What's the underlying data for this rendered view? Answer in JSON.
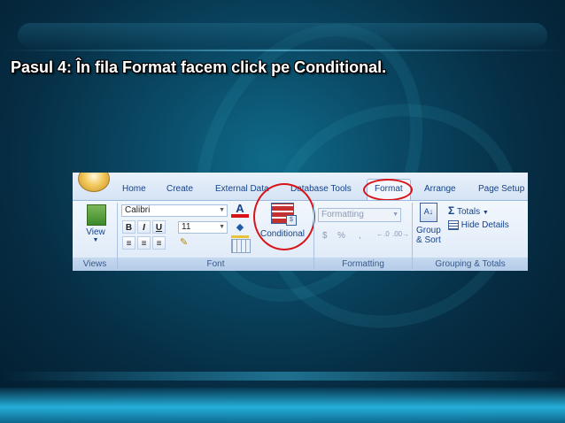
{
  "slide": {
    "title": "Pasul 4: În fila Format facem click pe Conditional."
  },
  "ribbon": {
    "tabs": [
      "Home",
      "Create",
      "External Data",
      "Database Tools",
      "Format",
      "Arrange",
      "Page Setup"
    ],
    "active_tab": "Format",
    "groups": {
      "views": {
        "label": "Views",
        "view_button": "View"
      },
      "font": {
        "label": "Font",
        "font_name": "Calibri",
        "font_size": "11",
        "bold": "B",
        "italic": "I",
        "underline": "U",
        "font_color_glyph": "A",
        "conditional_button": "Conditional"
      },
      "formatting": {
        "label": "Formatting",
        "format_box": "Formatting",
        "currency": "$",
        "percent": "%",
        "comma": ","
      },
      "grouping_totals": {
        "label": "Grouping & Totals",
        "totals": "Totals",
        "hide_details": "Hide Details",
        "group_sort_line1": "Group",
        "group_sort_line2": "& Sort"
      }
    }
  },
  "colors": {
    "highlight": "#d8141a",
    "ribbon_text": "#15428b"
  }
}
